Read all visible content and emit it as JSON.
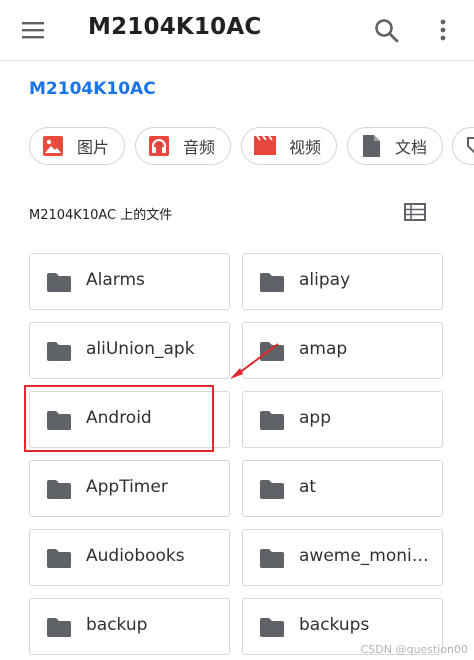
{
  "appbar": {
    "title": "M2104K10AC",
    "menu_icon": "hamburger-menu-icon",
    "search_icon": "search-icon",
    "more_icon": "more-vert-icon"
  },
  "breadcrumb": "M2104K10AC",
  "categories": [
    {
      "label": "图片",
      "icon": "image-icon",
      "color": "#e84c3d"
    },
    {
      "label": "音频",
      "icon": "headphones-icon",
      "color": "#e8453c"
    },
    {
      "label": "视频",
      "icon": "movie-icon",
      "color": "#e8453c"
    },
    {
      "label": "文档",
      "icon": "document-icon",
      "color": "#5f6368"
    }
  ],
  "section": {
    "title": "M2104K10AC 上的文件",
    "view_icon": "list-view-icon"
  },
  "folders": [
    "Alarms",
    "alipay",
    "aliUnion_apk",
    "amap",
    "Android",
    "app",
    "AppTimer",
    "at",
    "Audiobooks",
    "aweme_moni…",
    "backup",
    "backups"
  ],
  "annotation": {
    "highlight_color": "#e0282f",
    "highlighted_folder": "Android"
  },
  "watermark": "CSDN @question00"
}
